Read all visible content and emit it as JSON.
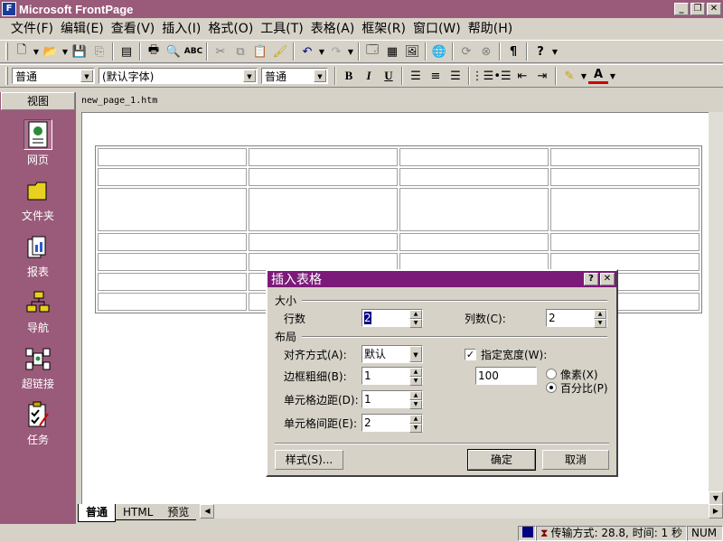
{
  "window": {
    "title": "Microsoft FrontPage"
  },
  "menu": [
    "文件(F)",
    "编辑(E)",
    "查看(V)",
    "插入(I)",
    "格式(O)",
    "工具(T)",
    "表格(A)",
    "框架(R)",
    "窗口(W)",
    "帮助(H)"
  ],
  "format_bar": {
    "style": "普通",
    "font": "(默认字体)",
    "size": "普通"
  },
  "views": {
    "header": "视图",
    "items": [
      {
        "label": "网页",
        "icon": "page-icon"
      },
      {
        "label": "文件夹",
        "icon": "folder-icon"
      },
      {
        "label": "报表",
        "icon": "reports-icon"
      },
      {
        "label": "导航",
        "icon": "navigation-icon"
      },
      {
        "label": "超链接",
        "icon": "hyperlinks-icon"
      },
      {
        "label": "任务",
        "icon": "tasks-icon"
      }
    ]
  },
  "document": {
    "tab": "new_page_1.htm"
  },
  "bottom_tabs": [
    "普通",
    "HTML",
    "预览"
  ],
  "status": {
    "transfer": "传输方式: 28.8, 时间: 1 秒",
    "num": "NUM"
  },
  "dialog": {
    "title": "插入表格",
    "size_group": "大小",
    "rows_label": "行数",
    "rows_value": "2",
    "cols_label": "列数(C):",
    "cols_value": "2",
    "layout_group": "布局",
    "align_label": "对齐方式(A):",
    "align_value": "默认",
    "border_label": "边框粗细(B):",
    "border_value": "1",
    "padding_label": "单元格边距(D):",
    "padding_value": "1",
    "spacing_label": "单元格间距(E):",
    "spacing_value": "2",
    "width_label": "指定宽度(W):",
    "width_value": "100",
    "pixels_label": "像素(X)",
    "percent_label": "百分比(P)",
    "style_button": "样式(S)...",
    "ok_button": "确定",
    "cancel_button": "取消"
  }
}
